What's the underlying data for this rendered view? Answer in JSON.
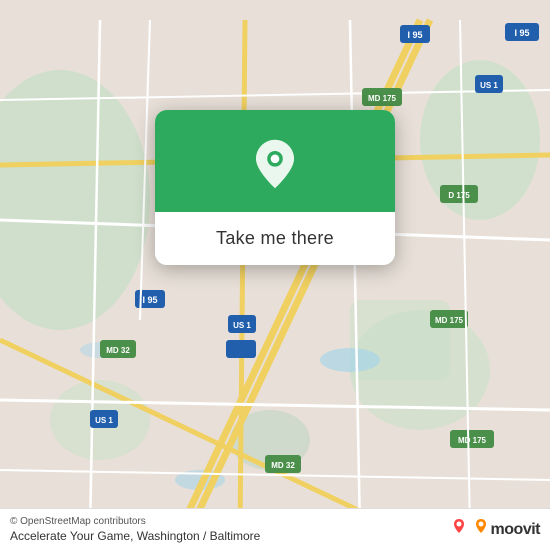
{
  "map": {
    "attribution": "© OpenStreetMap contributors",
    "title": "Accelerate Your Game, Washington / Baltimore"
  },
  "popup": {
    "button_label": "Take me there",
    "icon_name": "location-pin-icon"
  },
  "bottom_bar": {
    "attribution": "© OpenStreetMap contributors",
    "location_text": "Accelerate Your Game, Washington / Baltimore",
    "moovit_label": "moovit"
  },
  "colors": {
    "map_bg": "#e8e0d8",
    "green": "#2eaa5e",
    "highway_yellow": "#f0d060",
    "road_white": "#ffffff",
    "road_light": "#f5f0e8",
    "water": "#aad4e8",
    "green_area": "#c8dfc8"
  }
}
